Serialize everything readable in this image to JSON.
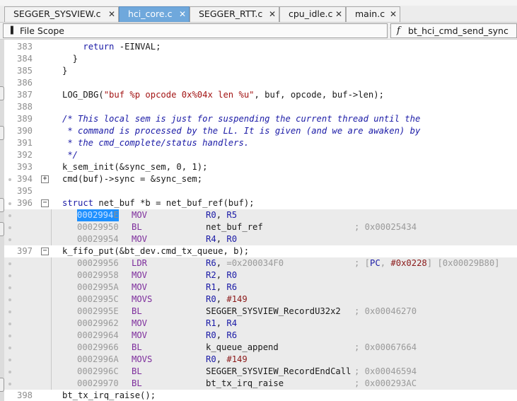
{
  "tabs": [
    {
      "label": "SEGGER_SYSVIEW.c",
      "close": "✕",
      "active": false
    },
    {
      "label": "hci_core.c",
      "close": "✕",
      "active": true
    },
    {
      "label": "SEGGER_RTT.c",
      "close": "✕",
      "active": false
    },
    {
      "label": "cpu_idle.c",
      "close": "✕",
      "active": false
    },
    {
      "label": "main.c",
      "close": "✕",
      "active": false
    }
  ],
  "toolbar": {
    "scope_label": "File Scope",
    "function_label": "bt_hci_cmd_send_sync",
    "function_icon": "f"
  },
  "colors": {
    "active_tab": "#6fa8dc",
    "keyword": "#1a1aa6",
    "string": "#a31515",
    "mnemonic": "#7d2d9c",
    "disasm_background": "#ebebeb",
    "selection": "#1e90ff"
  },
  "source": {
    "l383": {
      "num": "383",
      "text": "    return -EINVAL;"
    },
    "l384": {
      "num": "384",
      "text": "  }"
    },
    "l385": {
      "num": "385",
      "text": "}"
    },
    "l386": {
      "num": "386",
      "text": ""
    },
    "l387": {
      "num": "387",
      "pre": "LOG_DBG(",
      "str": "\"buf %p opcode 0x%04x len %u\"",
      "post": ", buf, opcode, buf->len);"
    },
    "l388": {
      "num": "388",
      "text": ""
    },
    "l389": {
      "num": "389",
      "text": "/* This local sem is just for suspending the current thread until the"
    },
    "l390": {
      "num": "390",
      "text": " * command is processed by the LL. It is given (and we are awaken) by"
    },
    "l391": {
      "num": "391",
      "text": " * the cmd_complete/status handlers."
    },
    "l392": {
      "num": "392",
      "text": " */"
    },
    "l393": {
      "num": "393",
      "text": "k_sem_init(&sync_sem, 0, 1);"
    },
    "l394": {
      "num": "394",
      "text": "cmd(buf)->sync = &sync_sem;",
      "fold": "+"
    },
    "l395": {
      "num": "395",
      "text": ""
    },
    "l396": {
      "num": "396",
      "kw": "struct",
      "text": " net_buf *b = net_buf_ref(buf);",
      "fold": "−"
    },
    "l397": {
      "num": "397",
      "text": "k_fifo_put(&bt_dev.cmd_tx_queue, b);",
      "fold": "−"
    },
    "l398": {
      "num": "398",
      "text": "bt_tx_irq_raise();"
    }
  },
  "disasm_a": [
    {
      "addr_sel": "0002994",
      "addr_tail": "E",
      "mnem": "MOV",
      "op1": "R0",
      "sep": ", ",
      "op2": "R5",
      "cmt": ""
    },
    {
      "addr": "00029950",
      "mnem": "BL",
      "sym": "net_buf_ref",
      "cmt": "; 0x00025434"
    },
    {
      "addr": "00029954",
      "mnem": "MOV",
      "op1": "R4",
      "sep": ", ",
      "op2": "R0",
      "cmt": ""
    }
  ],
  "disasm_b": [
    {
      "addr": "00029956",
      "mnem": "LDR",
      "op1": "R6",
      "sep": ", ",
      "op2": "=0x200034F0",
      "cmt_pre": "; [",
      "cmt_reg": "PC",
      "cmt_sep": ", ",
      "cmt_imm": "#0x0228",
      "cmt_post": "] [0x00029B80]"
    },
    {
      "addr": "00029958",
      "mnem": "MOV",
      "op1": "R2",
      "sep": ", ",
      "op2": "R0"
    },
    {
      "addr": "0002995A",
      "mnem": "MOV",
      "op1": "R1",
      "sep": ", ",
      "op2": "R6"
    },
    {
      "addr": "0002995C",
      "mnem": "MOVS",
      "op1": "R0",
      "sep": ", ",
      "imm": "#149"
    },
    {
      "addr": "0002995E",
      "mnem": "BL",
      "sym": "SEGGER_SYSVIEW_RecordU32x2",
      "cmt": "; 0x00046270"
    },
    {
      "addr": "00029962",
      "mnem": "MOV",
      "op1": "R1",
      "sep": ", ",
      "op2": "R4"
    },
    {
      "addr": "00029964",
      "mnem": "MOV",
      "op1": "R0",
      "sep": ", ",
      "op2": "R6"
    },
    {
      "addr": "00029966",
      "mnem": "BL",
      "sym": "k_queue_append",
      "cmt": "; 0x00067664"
    },
    {
      "addr": "0002996A",
      "mnem": "MOVS",
      "op1": "R0",
      "sep": ", ",
      "imm": "#149"
    },
    {
      "addr": "0002996C",
      "mnem": "BL",
      "sym": "SEGGER_SYSVIEW_RecordEndCall",
      "cmt": "; 0x00046594"
    },
    {
      "addr": "00029970",
      "mnem": "BL",
      "sym": "bt_tx_irq_raise",
      "cmt": "; 0x000293AC"
    }
  ]
}
